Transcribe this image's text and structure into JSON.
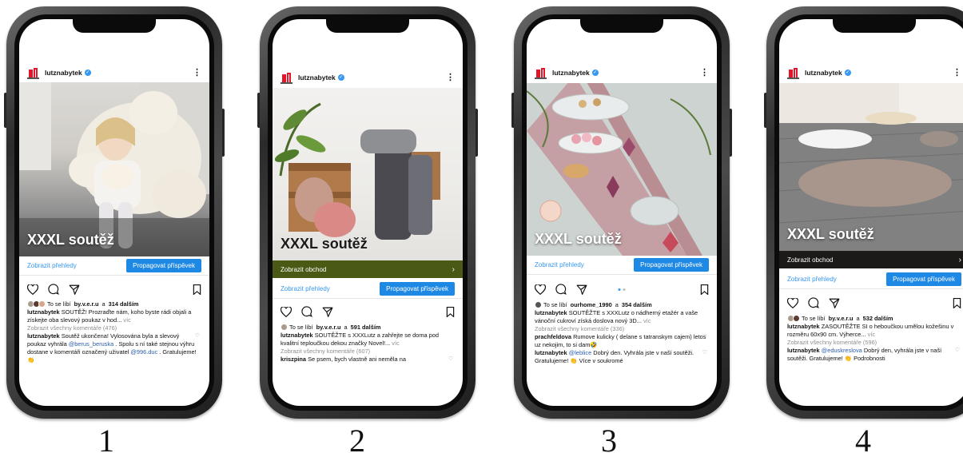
{
  "account": {
    "username": "lutznabytek"
  },
  "common": {
    "insights": "Zobrazit přehledy",
    "promote": "Propagovat příspěvek",
    "shop": "Zobrazit obchod",
    "more_word": "víc"
  },
  "phones": [
    {
      "number": "1",
      "overlay": "XXXL soutěž",
      "liked_by_prefix": "To se líbí",
      "liked_by_user": "by.v.e.r.u",
      "liked_by_mid": "a",
      "liked_by_count": "314 dalším",
      "caption_text": "SOUTĚŽ! Prozraďte nám, koho byste rádi objali a získejte oba slevový poukaz v hod...",
      "view_comments": "Zobrazit všechny komentáře (476)",
      "comment1_user": "lutznabytek",
      "comment1_text_a": "Soutěž ukončena! Vylosována byla a slevový poukaz vyhrála",
      "comment1_mention": "@berus_beruska",
      "comment1_text_b": ". Spolu s ní také stejnou výhru dostane v komentáři označený uživatel",
      "comment1_mention2": "@996.duc",
      "comment1_text_c": ". Gratulujeme! 👏"
    },
    {
      "number": "2",
      "overlay": "XXXL soutěž",
      "liked_by_prefix": "To se líbí",
      "liked_by_user": "by.v.e.r.u",
      "liked_by_mid": "a",
      "liked_by_count": "591 dalším",
      "caption_text": "SOUTĚŽTE s XXXLutz a zahřejte se doma pod kvalitní teploučkou dekou značky Novel!...",
      "view_comments": "Zobrazit všechny komentáře (607)",
      "comment1_user": "kriszpina",
      "comment1_text_a": "Se psem, bych vlastně ani  neměla na"
    },
    {
      "number": "3",
      "overlay": "XXXL soutěž",
      "liked_by_prefix": "To se líbí",
      "liked_by_user": "ourhome_1990",
      "liked_by_mid": "a",
      "liked_by_count": "354 dalším",
      "caption_text": "SOUTĚŽTE s XXXLutz o nádherný etažér a vaše vánoční cukroví získá doslova nový 3D...",
      "view_comments": "Zobrazit všechny komentáře (336)",
      "comment1_user": "prachfeldova",
      "comment1_text_a": "Rumove kulicky ( delane s tatranskym cajem) letos uz nekojim, to si dam🤣",
      "comment2_user": "lutznabytek",
      "comment2_mention": "@leblice",
      "comment2_text": "Dobrý den. Vyhrála jste v naší soutěži. Gratulujeme! 👏 Více v soukromé"
    },
    {
      "number": "4",
      "overlay": "XXXL soutěž",
      "liked_by_prefix": "To se líbí",
      "liked_by_user": "by.v.e.r.u",
      "liked_by_mid": "a",
      "liked_by_count": "532 dalším",
      "caption_text": "ZASOUTĚŽTE SI o heboučkou umělou kožešinu v rozměru 60x90 cm. Výherce...",
      "view_comments": "Zobrazit všechny komentáře (596)",
      "comment1_user": "lutznabytek",
      "comment1_mention": "@eduskreslova",
      "comment1_text_a": "Dobrý den, vyhrála jste v naší soutěži. Gratulujeme! 👏 Podrobnosti"
    }
  ],
  "colors": {
    "instagram_blue": "#3897f0",
    "promote_blue": "#1e88e5",
    "shop_bar_green": "#4a5a14",
    "shop_bar_dark": "#1c1a18",
    "brand_red": "#e2162b"
  }
}
